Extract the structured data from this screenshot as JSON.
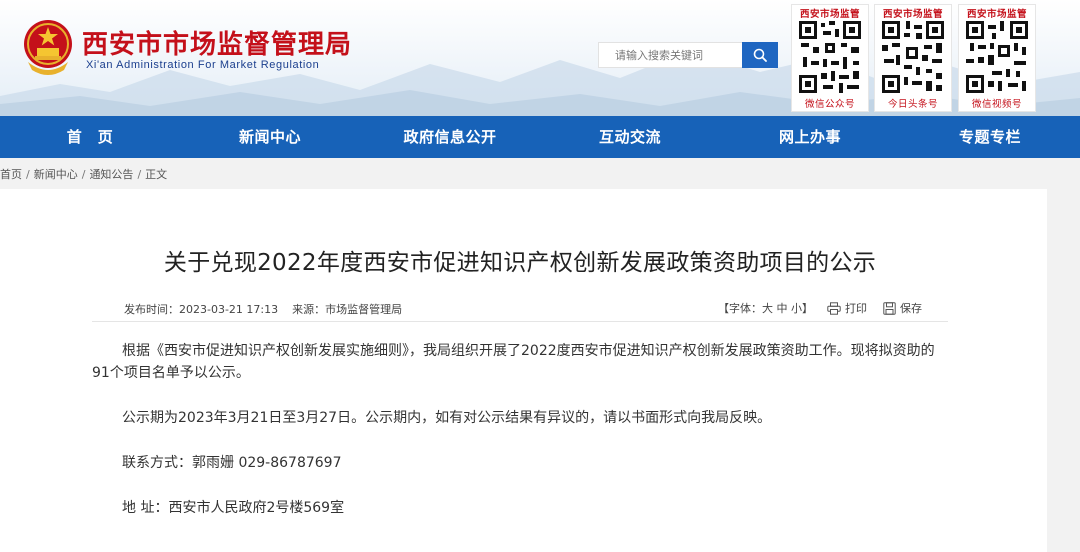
{
  "header": {
    "title": "西安市市场监督管理局",
    "subtitle": "Xi'an Administration For Market Regulation",
    "search": {
      "placeholder": "请输入搜索关键词"
    },
    "qr_codes": [
      {
        "top": "西安市场监管",
        "bottom": "微信公众号"
      },
      {
        "top": "西安市场监管",
        "bottom": "今日头条号"
      },
      {
        "top": "西安市场监管",
        "bottom": "微信视频号"
      }
    ]
  },
  "nav": {
    "items": [
      "首　页",
      "新闻中心",
      "政府信息公开",
      "互动交流",
      "网上办事",
      "专题专栏"
    ]
  },
  "breadcrumb": {
    "items": [
      "首页",
      "新闻中心",
      "通知公告",
      "正文"
    ],
    "separator": "/"
  },
  "article": {
    "title": "关于兑现2022年度西安市促进知识产权创新发展政策资助项目的公示",
    "meta": {
      "time_label": "发布时间：",
      "time": "2023-03-21 17:13",
      "source_label": "来源：",
      "source": "市场监督管理局",
      "font_label": "【字体：",
      "font_large": "大",
      "font_medium": "中",
      "font_small": "小",
      "font_end": "】",
      "print": "打印",
      "save": "保存"
    },
    "paragraphs": [
      "根据《西安市促进知识产权创新发展实施细则》，我局组织开展了2022度西安市促进知识产权创新发展政策资助工作。现将拟资助的91个项目名单予以公示。",
      "公示期为2023年3月21日至3月27日。公示期内，如有对公示结果有异议的，请以书面形式向我局反映。",
      "联系方式：郭雨姗 029-86787697",
      "地 址：西安市人民政府2号楼569室"
    ]
  },
  "colors": {
    "brand_red": "#c4101a",
    "nav_blue": "#1762b8",
    "search_blue": "#1f66c1"
  }
}
